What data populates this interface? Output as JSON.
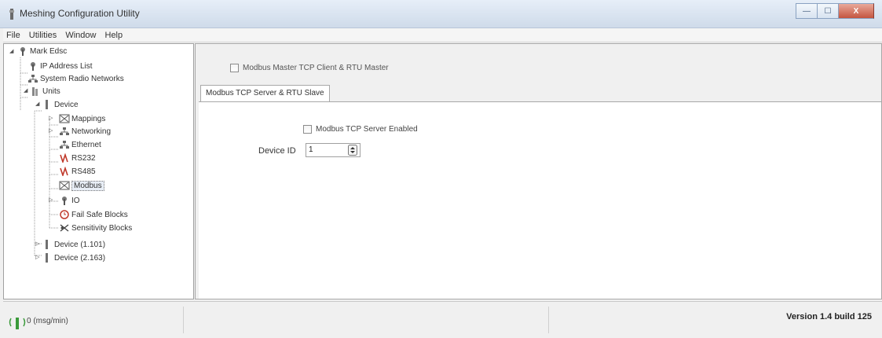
{
  "window": {
    "title": "Meshing Configuration Utility"
  },
  "window_buttons": {
    "minimize": "—",
    "maximize": "☐",
    "close": "X"
  },
  "menu": [
    "File",
    "Utilities",
    "Window",
    "Help"
  ],
  "tree": {
    "root": "Mark Edsc",
    "ip_list": "IP Address List",
    "radio_networks": "System Radio Networks",
    "units": "Units",
    "device": "Device",
    "children": [
      "Mappings",
      "Networking",
      "Ethernet",
      "RS232",
      "RS485",
      "Modbus",
      "IO",
      "Fail Safe Blocks",
      "Sensitivity Blocks"
    ],
    "other_devices": [
      "Device (1.101)",
      "Device (2.163)"
    ]
  },
  "master_checkbox": {
    "label": "Modbus Master TCP Client & RTU Master",
    "checked": false
  },
  "tab": {
    "label": "Modbus TCP Server & RTU Slave"
  },
  "server_checkbox": {
    "label": "Modbus TCP Server Enabled",
    "checked": false
  },
  "device_id": {
    "label": "Device ID",
    "value": "1"
  },
  "status": {
    "rate": "0 (msg/min)",
    "version": "Version 1.4 build 125"
  }
}
